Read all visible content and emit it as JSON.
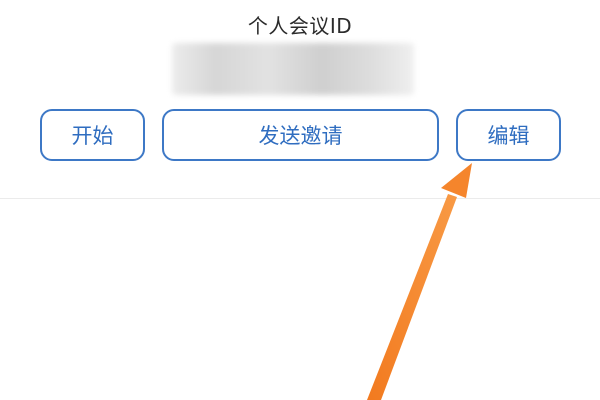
{
  "meeting": {
    "title": "个人会议ID"
  },
  "buttons": {
    "start": "开始",
    "send_invite": "发送邀请",
    "edit": "编辑"
  },
  "colors": {
    "button_border": "#3d78c6",
    "button_text": "#2f6dc0",
    "arrow": "#f5852c"
  },
  "annotation": {
    "icon": "arrow-icon"
  }
}
